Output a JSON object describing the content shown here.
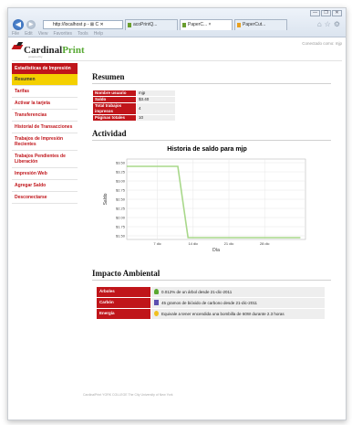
{
  "browser": {
    "address": "http://localhost ρ - ⊠ C ✕",
    "tabs": [
      {
        "label": "acoPrintQ..."
      },
      {
        "label": "PaperC... ×"
      },
      {
        "label": "PaperCut..."
      }
    ],
    "menu": [
      "File",
      "Edit",
      "View",
      "Favorites",
      "Tools",
      "Help"
    ],
    "window_buttons": [
      "—",
      "❐",
      "✕"
    ]
  },
  "header": {
    "logo_part1": "Cardinal",
    "logo_part2": "Print",
    "tagline": "powered by",
    "user": "Conectado como: mjp"
  },
  "sidebar": {
    "heading": "Estadísticas de Impresión",
    "items": [
      {
        "label": "Resumen"
      },
      {
        "label": "Tarifas"
      },
      {
        "label": "Activar la tarjeta"
      },
      {
        "label": "Transferencias"
      },
      {
        "label": "Historial de Transacciones"
      },
      {
        "label": "Trabajos de Impresión Recientes"
      },
      {
        "label": "Trabajos Pendientes de Liberación"
      },
      {
        "label": "Impresión Web"
      },
      {
        "label": "Agregar Saldo"
      },
      {
        "label": "Desconectarse"
      }
    ]
  },
  "summary": {
    "heading": "Resumen",
    "rows": [
      {
        "key": "Nombre usuario",
        "value": "mjp"
      },
      {
        "key": "Saldo",
        "value": "$3.40"
      },
      {
        "key": "Total trabajos impresos",
        "value": "4"
      },
      {
        "key": "Páginas totales",
        "value": "10"
      }
    ]
  },
  "activity": {
    "heading": "Actividad"
  },
  "chart_data": {
    "type": "line",
    "title": "Historia de saldo para mjp",
    "xlabel": "Día",
    "ylabel": "Saldo",
    "x_ticks": [
      "7 dic",
      "14 dic",
      "21 dic",
      "28 dic"
    ],
    "y_ticks": [
      "$3.50",
      "$3.25",
      "$3.00",
      "$2.75",
      "$2.50",
      "$2.25",
      "$2.00",
      "$1.75",
      "$1.50"
    ],
    "ylim": [
      1.4,
      3.6
    ],
    "series": [
      {
        "color": "#a8d88a",
        "points": [
          {
            "x": 1,
            "y": 3.4
          },
          {
            "x": 11,
            "y": 3.4
          },
          {
            "x": 13,
            "y": 1.45
          },
          {
            "x": 35,
            "y": 1.45
          }
        ]
      }
    ],
    "xlim": [
      1,
      36
    ],
    "grid": true
  },
  "environment": {
    "heading": "Impacto Ambiental",
    "rows": [
      {
        "key": "Árboles",
        "icon": "tree-icon",
        "color": "#5aa830",
        "value": "0.012% de un árbol desde 21-dic-2011"
      },
      {
        "key": "Carbón",
        "icon": "carbon-icon",
        "color": "#5b4fb0",
        "value": "45 gramos de bióxido de carbono desde 21-dic-2011"
      },
      {
        "key": "Energía",
        "icon": "bulb-icon",
        "color": "#f0c020",
        "value": "Equivale a tener encendida una bombilla de 60W durante 2.3 horas"
      }
    ]
  },
  "footer": {
    "text": "CardinalPrint YORK COLLEGE The City University of New York"
  },
  "colors": {
    "brand_red": "#c0151a",
    "active_yellow": "#f4d000",
    "brand_green": "#56a832"
  }
}
